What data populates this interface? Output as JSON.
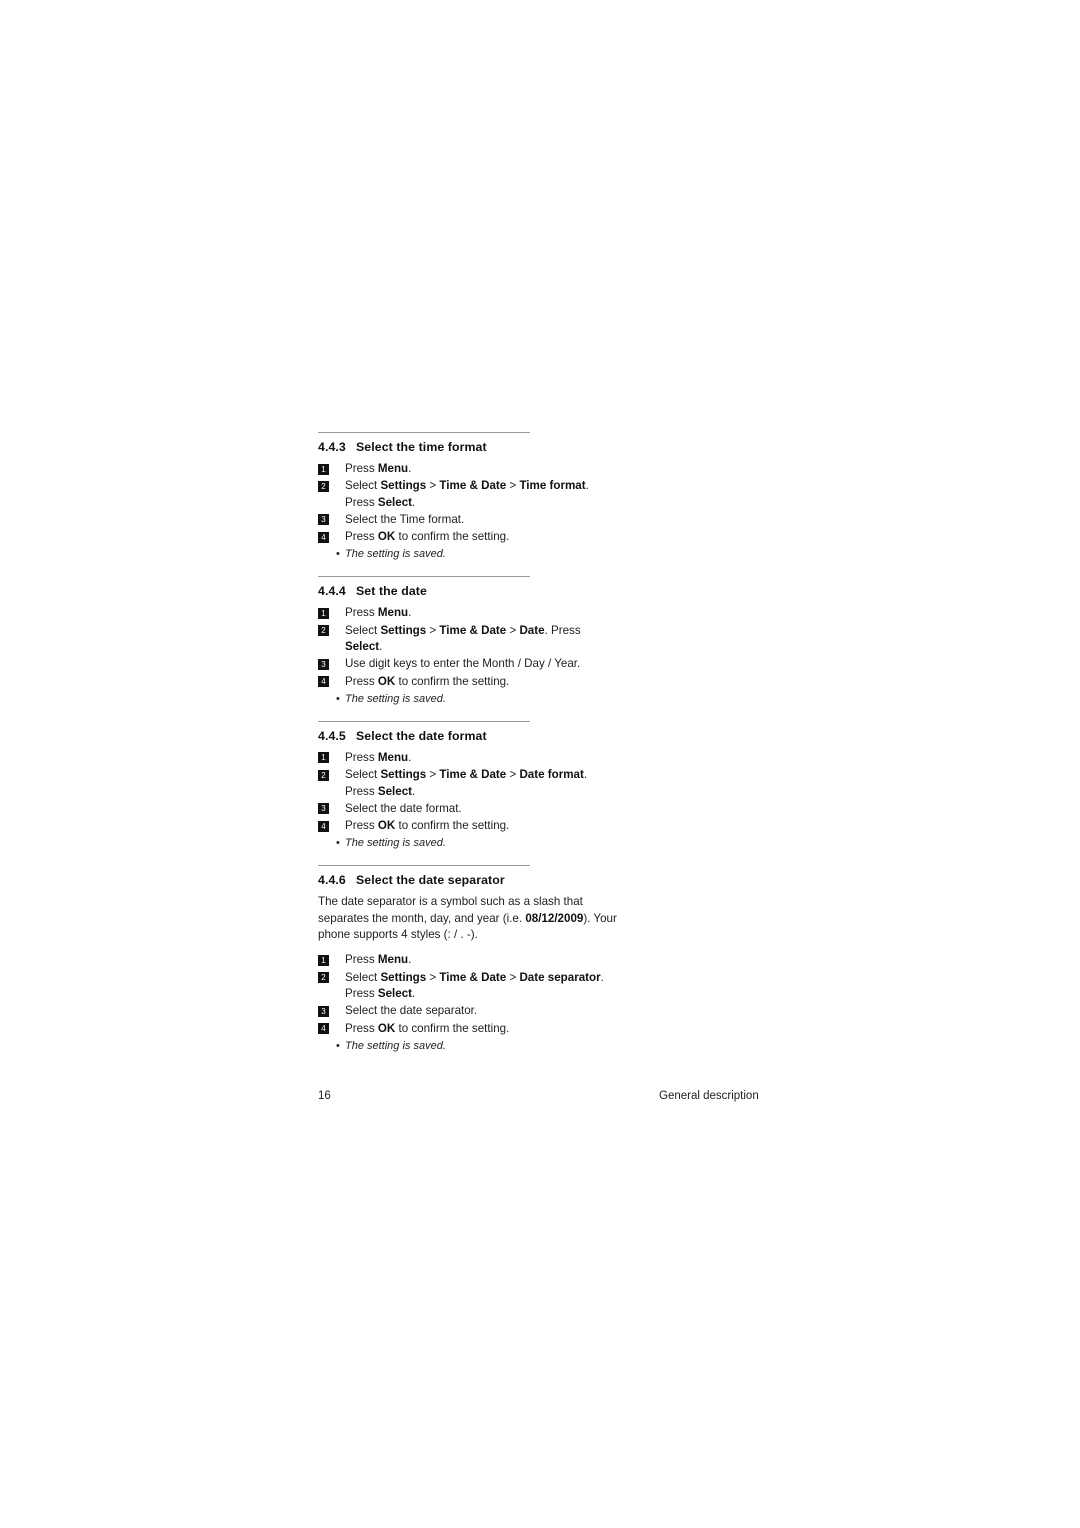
{
  "page": {
    "number": "16",
    "footer_text": "General description"
  },
  "sections": [
    {
      "number": "4.4.3",
      "title": "Select the time format",
      "steps": [
        {
          "badge": "1",
          "parts": [
            {
              "t": "Press ",
              "b": false
            },
            {
              "t": "Menu",
              "b": true
            },
            {
              "t": ".",
              "b": false
            }
          ]
        },
        {
          "badge": "2",
          "parts": [
            {
              "t": "Select ",
              "b": false
            },
            {
              "t": "Settings",
              "b": true
            },
            {
              "t": " > ",
              "b": false
            },
            {
              "t": "Time & Date",
              "b": true
            },
            {
              "t": " > ",
              "b": false
            },
            {
              "t": "Time format",
              "b": true
            },
            {
              "t": ". Press ",
              "b": false
            },
            {
              "t": "Select",
              "b": true
            },
            {
              "t": ".",
              "b": false
            }
          ]
        },
        {
          "badge": "3",
          "parts": [
            {
              "t": "Select the Time format.",
              "b": false
            }
          ]
        },
        {
          "badge": "4",
          "parts": [
            {
              "t": "Press ",
              "b": false
            },
            {
              "t": "OK",
              "b": true
            },
            {
              "t": " to confirm the setting.",
              "b": false
            }
          ]
        }
      ],
      "note": "The setting is saved."
    },
    {
      "number": "4.4.4",
      "title": "Set the date",
      "steps": [
        {
          "badge": "1",
          "parts": [
            {
              "t": "Press ",
              "b": false
            },
            {
              "t": "Menu",
              "b": true
            },
            {
              "t": ".",
              "b": false
            }
          ]
        },
        {
          "badge": "2",
          "parts": [
            {
              "t": "Select ",
              "b": false
            },
            {
              "t": "Settings",
              "b": true
            },
            {
              "t": " > ",
              "b": false
            },
            {
              "t": "Time & Date",
              "b": true
            },
            {
              "t": " > ",
              "b": false
            },
            {
              "t": "Date",
              "b": true
            },
            {
              "t": ". Press ",
              "b": false
            },
            {
              "t": "Select",
              "b": true
            },
            {
              "t": ".",
              "b": false
            }
          ]
        },
        {
          "badge": "3",
          "parts": [
            {
              "t": "Use digit keys to enter the Month / Day / Year.",
              "b": false
            }
          ]
        },
        {
          "badge": "4",
          "parts": [
            {
              "t": "Press ",
              "b": false
            },
            {
              "t": "OK",
              "b": true
            },
            {
              "t": " to confirm the setting.",
              "b": false
            }
          ]
        }
      ],
      "note": "The setting is saved."
    },
    {
      "number": "4.4.5",
      "title": "Select the date format",
      "steps": [
        {
          "badge": "1",
          "parts": [
            {
              "t": "Press ",
              "b": false
            },
            {
              "t": "Menu",
              "b": true
            },
            {
              "t": ".",
              "b": false
            }
          ]
        },
        {
          "badge": "2",
          "parts": [
            {
              "t": "Select ",
              "b": false
            },
            {
              "t": "Settings",
              "b": true
            },
            {
              "t": " > ",
              "b": false
            },
            {
              "t": "Time & Date",
              "b": true
            },
            {
              "t": " > ",
              "b": false
            },
            {
              "t": "Date format",
              "b": true
            },
            {
              "t": ". Press ",
              "b": false
            },
            {
              "t": "Select",
              "b": true
            },
            {
              "t": ".",
              "b": false
            }
          ]
        },
        {
          "badge": "3",
          "parts": [
            {
              "t": "Select the date format.",
              "b": false
            }
          ]
        },
        {
          "badge": "4",
          "parts": [
            {
              "t": "Press ",
              "b": false
            },
            {
              "t": "OK",
              "b": true
            },
            {
              "t": " to confirm the setting.",
              "b": false
            }
          ]
        }
      ],
      "note": "The setting is saved."
    },
    {
      "number": "4.4.6",
      "title": "Select the date separator",
      "intro_parts": [
        {
          "t": "The date separator is a symbol such as a slash that separates the month, day, and year (i.e. ",
          "b": false
        },
        {
          "t": "08/12/2009",
          "b": true
        },
        {
          "t": "). Your phone supports 4 styles (: / . -).",
          "b": false
        }
      ],
      "steps": [
        {
          "badge": "1",
          "parts": [
            {
              "t": "Press ",
              "b": false
            },
            {
              "t": "Menu",
              "b": true
            },
            {
              "t": ".",
              "b": false
            }
          ]
        },
        {
          "badge": "2",
          "parts": [
            {
              "t": "Select ",
              "b": false
            },
            {
              "t": "Settings",
              "b": true
            },
            {
              "t": " > ",
              "b": false
            },
            {
              "t": "Time & Date",
              "b": true
            },
            {
              "t": " > ",
              "b": false
            },
            {
              "t": "Date separator",
              "b": true
            },
            {
              "t": ". Press ",
              "b": false
            },
            {
              "t": "Select",
              "b": true
            },
            {
              "t": ".",
              "b": false
            }
          ]
        },
        {
          "badge": "3",
          "parts": [
            {
              "t": "Select the date separator.",
              "b": false
            }
          ]
        },
        {
          "badge": "4",
          "parts": [
            {
              "t": "Press ",
              "b": false
            },
            {
              "t": "OK",
              "b": true
            },
            {
              "t": " to confirm the setting.",
              "b": false
            }
          ]
        }
      ],
      "note": "The setting is saved."
    }
  ],
  "bullet_glyph": "•"
}
